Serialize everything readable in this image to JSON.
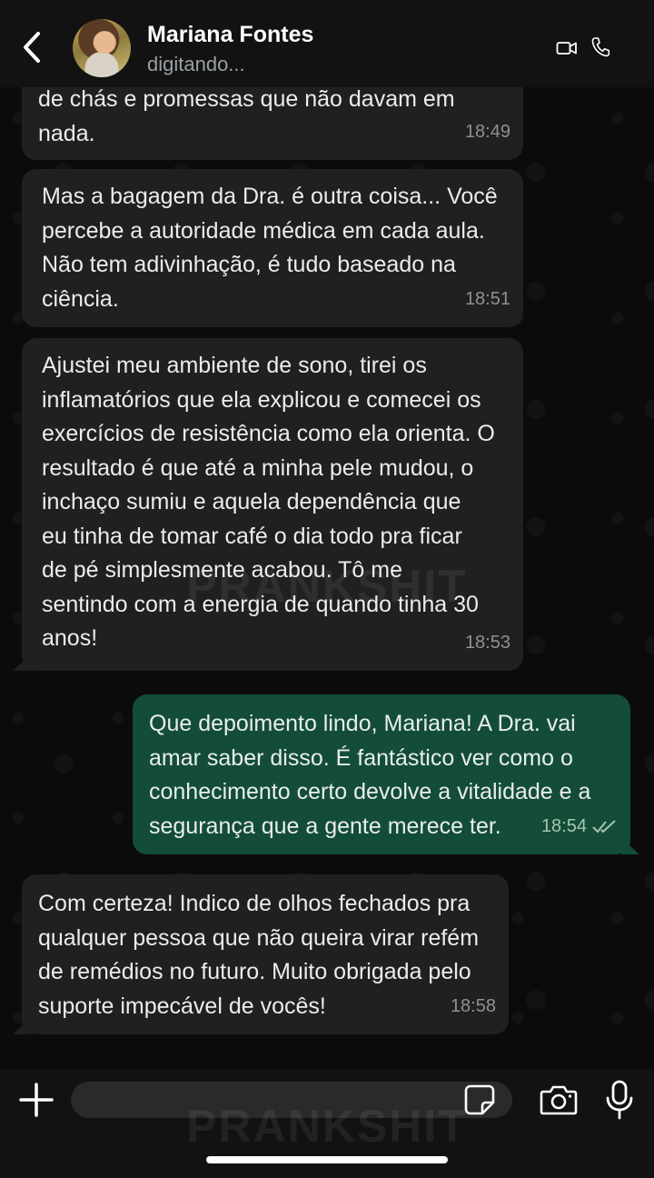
{
  "header": {
    "contact_name": "Mariana Fontes",
    "status": "digitando...",
    "back_icon": "chevron-left-icon",
    "video_icon": "video-camera-icon",
    "call_icon": "phone-icon"
  },
  "watermark": "PRANKSHIT",
  "messages": [
    {
      "direction": "in",
      "text": "de chás e promessas que não davam em\nnada.",
      "time": "18:49"
    },
    {
      "direction": "in",
      "text": "Mas a bagagem da Dra. é outra coisa... Você\npercebe a autoridade médica em cada aula.\nNão tem adivinhação, é tudo baseado na\nciência.",
      "time": "18:51"
    },
    {
      "direction": "in",
      "text": "Ajustei meu ambiente de sono, tirei os\ninflamatórios que ela explicou e comecei os\nexercícios de resistência como ela orienta. O\nresultado é que até a minha pele mudou, o\ninchaço sumiu e aquela dependência que\neu tinha de tomar café o dia todo pra ficar\nde pé simplesmente acabou. Tô me\nsentindo com a energia de quando tinha 30\nanos!",
      "time": "18:53"
    },
    {
      "direction": "out",
      "text": "Que depoimento lindo, Mariana! A Dra. vai\namar saber disso. É fantástico ver como o\nconhecimento certo devolve a vitalidade e a\nsegurança que a gente merece ter.",
      "time": "18:54",
      "read_icon": "double-check-icon"
    },
    {
      "direction": "in",
      "text": "Com certeza! Indico de olhos fechados pra\nqualquer pessoa que não queira virar refém\nde remédios no futuro. Muito obrigada pelo\nsuporte impecável de vocês!",
      "time": "18:58"
    }
  ],
  "composer": {
    "placeholder": "",
    "plus_icon": "plus-icon",
    "sticker_icon": "sticker-icon",
    "camera_icon": "camera-icon",
    "mic_icon": "microphone-icon"
  },
  "colors": {
    "header_bg": "#121212",
    "incoming_bubble": "#202020",
    "outgoing_bubble": "#134d37",
    "background": "#0b0b0b"
  }
}
